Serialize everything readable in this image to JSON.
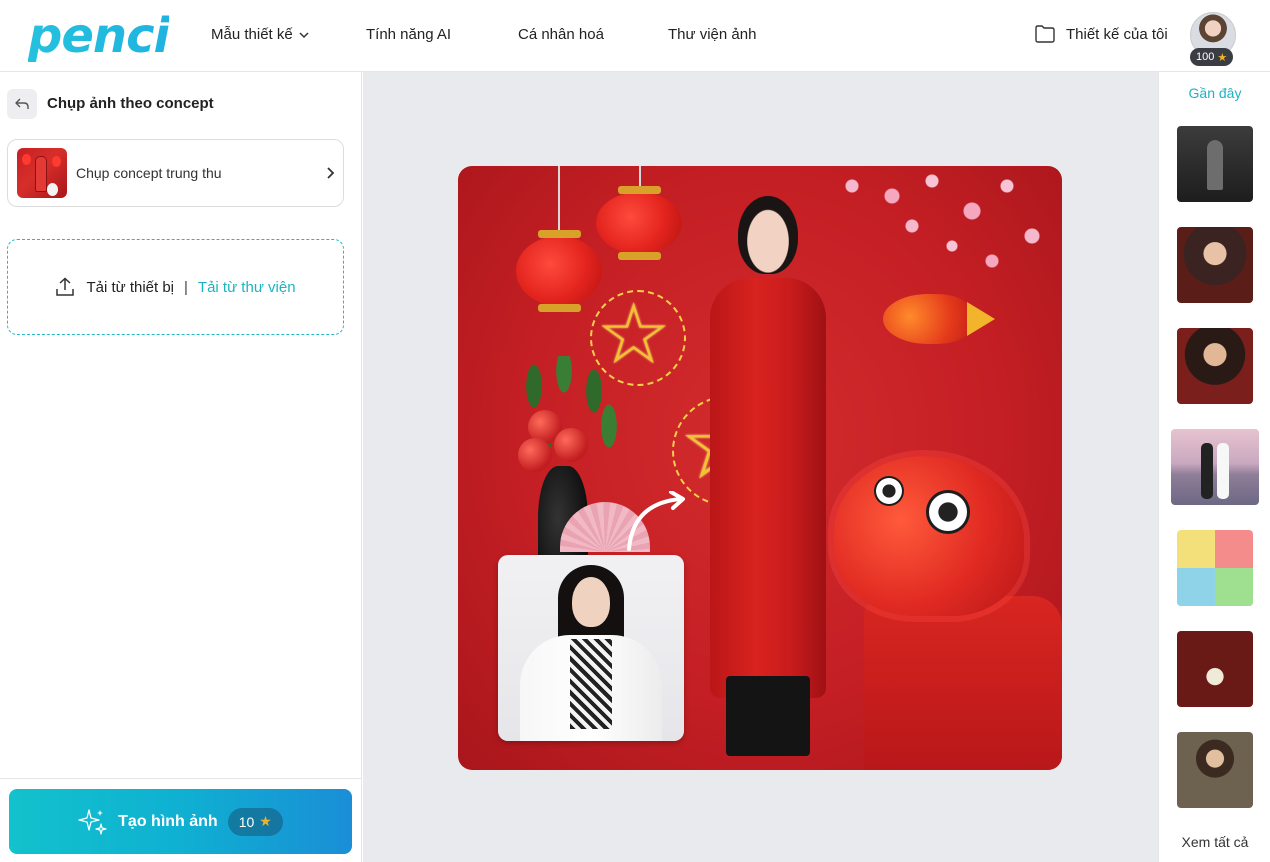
{
  "brand": {
    "logo_text": "penci",
    "accent_color": "#1db3c2"
  },
  "nav": {
    "items": [
      {
        "label": "Mẫu thiết kế",
        "has_dropdown": true
      },
      {
        "label": "Tính năng AI"
      },
      {
        "label": "Cá nhân hoá"
      },
      {
        "label": "Thư viện ảnh"
      }
    ]
  },
  "header": {
    "my_designs_label": "Thiết kế của tôi",
    "my_designs_icon": "folder-icon",
    "user_credits": "100",
    "credit_icon": "star-icon"
  },
  "left_panel": {
    "title": "Chụp ảnh theo concept",
    "back_icon": "reply-arrow-icon",
    "concept_card": {
      "label": "Chụp concept trung thu"
    },
    "upload": {
      "device_label": "Tải từ thiết bị",
      "separator": "|",
      "library_label": "Tải từ thư viện"
    },
    "generate": {
      "label": "Tạo hình ảnh",
      "cost": "10",
      "icon": "sparkles-icon"
    }
  },
  "right_rail": {
    "title": "Gần đây",
    "thumb_count": 7,
    "see_all_label": "Xem tất cả"
  },
  "colors": {
    "generate_gradient_start": "#12c2cc",
    "generate_gradient_end": "#1a8ed6",
    "canvas_bg": "#e9eaee",
    "credit_pill_bg": "#3a3d44",
    "star": "#f2b322"
  }
}
